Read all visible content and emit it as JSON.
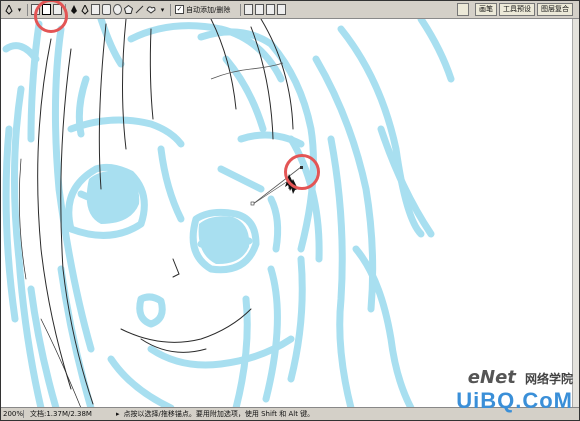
{
  "toolbar": {
    "autoadd_label": "自动添加/删除",
    "autoadd_checked": "✓"
  },
  "panel_tabs": [
    "画笔",
    "工具预设",
    "图层复合"
  ],
  "status": {
    "zoom": "200%",
    "doc": "文档:1.37M/2.38M",
    "hint": "点按以选择/拖移锚点。要用附加选项，使用 Shift 和 Alt 键。"
  },
  "watermark": {
    "top": "eNet",
    "top_cn": "网络学院",
    "bottom": "UiBQ.CoM"
  },
  "colors": {
    "sketch": "#a8dff0",
    "lineart": "#2a2a2a",
    "highlight": "#e35555",
    "panel": "#d4d0c8"
  }
}
